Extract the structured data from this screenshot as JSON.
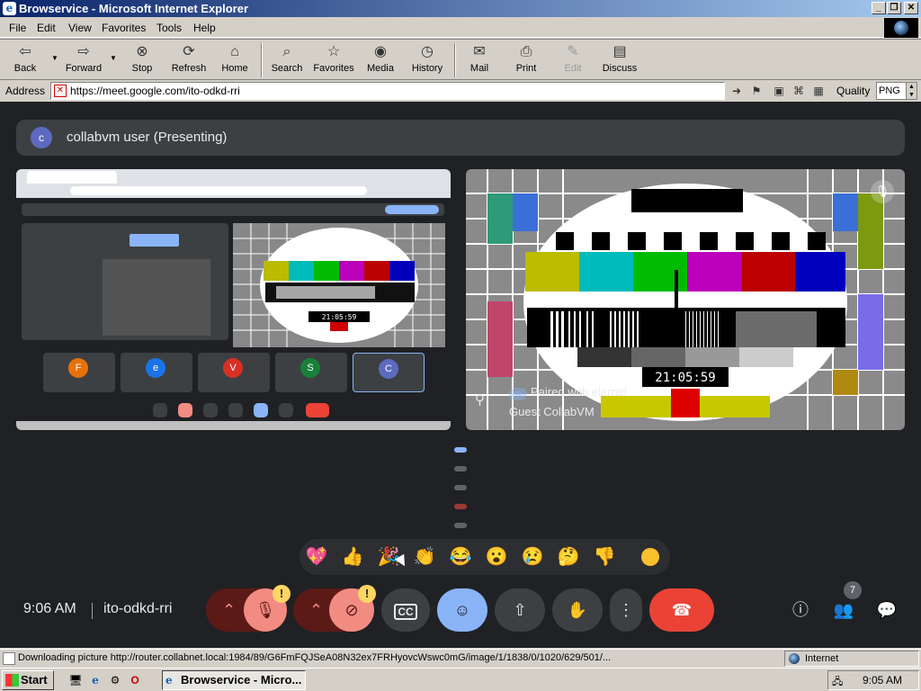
{
  "window": {
    "title": "Browservice - Microsoft Internet Explorer",
    "controls": [
      "_",
      "❐",
      "✕"
    ]
  },
  "menu": [
    "File",
    "Edit",
    "View",
    "Favorites",
    "Tools",
    "Help"
  ],
  "toolbar": {
    "buttons": [
      {
        "label": "Back",
        "icon": "back-arrow-icon"
      },
      {
        "label": "Forward",
        "icon": "forward-arrow-icon"
      },
      {
        "label": "Stop",
        "icon": "stop-icon"
      },
      {
        "label": "Refresh",
        "icon": "refresh-icon"
      },
      {
        "label": "Home",
        "icon": "home-icon"
      },
      {
        "label": "Search",
        "icon": "search-icon"
      },
      {
        "label": "Favorites",
        "icon": "favorites-icon"
      },
      {
        "label": "Media",
        "icon": "media-icon"
      },
      {
        "label": "History",
        "icon": "history-icon"
      },
      {
        "label": "Mail",
        "icon": "mail-icon"
      },
      {
        "label": "Print",
        "icon": "print-icon"
      },
      {
        "label": "Edit",
        "icon": "edit-icon",
        "disabled": true
      },
      {
        "label": "Discuss",
        "icon": "discuss-icon"
      }
    ]
  },
  "address": {
    "label": "Address",
    "url": "https://meet.google.com/ito-odkd-rri",
    "quality_label": "Quality",
    "quality_value": "PNG"
  },
  "meet": {
    "presenter": {
      "initial": "c",
      "label": "collabvm user (Presenting)"
    },
    "share_thumbnails": [
      {
        "initial": "F",
        "color": "#e8710a"
      },
      {
        "initial": "e",
        "color": "#1a73e8"
      },
      {
        "initial": "V",
        "color": "#d93025"
      },
      {
        "initial": "S",
        "color": "#188038"
      },
      {
        "initial": "C",
        "color": "#5c6bc0"
      }
    ],
    "guest_tile": {
      "paired_text": "Paired with elernel",
      "name": "Guest CollabVM",
      "test_clock": "21:05:59"
    },
    "reactions": [
      "💖",
      "👍",
      "🎉",
      "👏",
      "😂",
      "😮",
      "😢",
      "🤔",
      "👎"
    ],
    "time": "9:06 AM",
    "meeting_code": "ito-odkd-rri",
    "people_count": "7",
    "colors": {
      "bg": "#202124",
      "surface": "#3c4043",
      "accent": "#8ab4f8",
      "end_call": "#ea4335",
      "warning": "#fdd663"
    }
  },
  "status": {
    "text": "Downloading picture http://router.collabnet.local:1984/89/G6FmFQJSeA08N32ex7FRHyovcWswc0mG/image/1/1838/0/1020/629/501/...",
    "zone": "Internet"
  },
  "taskbar": {
    "start_label": "Start",
    "task_label": "Browservice - Micro...",
    "clock": "9:05 AM"
  }
}
